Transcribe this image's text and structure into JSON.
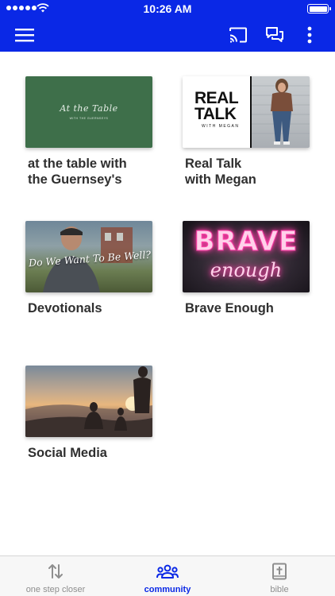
{
  "status_bar": {
    "time": "10:26 AM"
  },
  "app_bar": {
    "icons": [
      "menu-icon",
      "cast-icon",
      "chat-icon",
      "more-vertical-icon"
    ],
    "color": "#0a28e6"
  },
  "cards": [
    {
      "title_line1": "at the table with",
      "title_line2": "the Guernsey's",
      "thumb_text": "At the Table",
      "thumb_subtext": "WITH THE GUERNSEYS"
    },
    {
      "title_line1": "Real Talk",
      "title_line2": "with Megan",
      "thumb_text_line1": "REAL",
      "thumb_text_line2": "TALK",
      "thumb_subtext": "WITH MEGAN"
    },
    {
      "title_line1": "Devotionals",
      "title_line2": "",
      "thumb_text": "Do We Want To Be Well?"
    },
    {
      "title_line1": "Brave Enough",
      "title_line2": "",
      "thumb_text_line1": "BRAVE",
      "thumb_text_line2": "enough"
    },
    {
      "title_line1": "Social Media",
      "title_line2": ""
    }
  ],
  "tab_bar": {
    "tabs": [
      {
        "label": "one step closer",
        "icon": "sort-arrows-icon",
        "active": false
      },
      {
        "label": "community",
        "icon": "people-group-icon",
        "active": true
      },
      {
        "label": "bible",
        "icon": "bible-icon",
        "active": false
      }
    ],
    "active_color": "#0a28e6"
  }
}
